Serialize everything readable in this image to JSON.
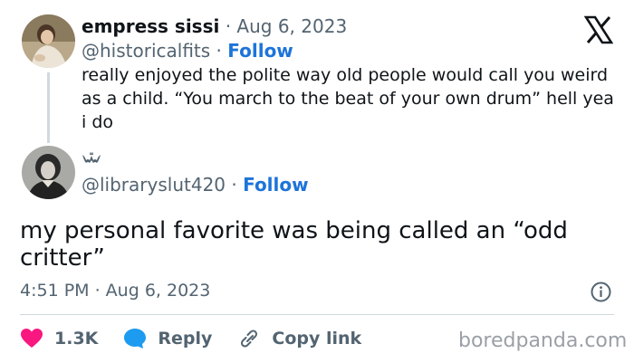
{
  "parent_tweet": {
    "display_name": "empress sissi",
    "separator": "·",
    "date": "Aug 6, 2023",
    "handle": "@historicalfits",
    "follow_label": "Follow",
    "text": "really enjoyed the polite way old people would call you weird as a child. “You march to the beat of your own drum” hell yea i do",
    "avatar_icon": "portrait-avatar"
  },
  "reply_tweet": {
    "name_icon": "bat-icon",
    "handle": "@libraryslut420",
    "separator": "·",
    "follow_label": "Follow",
    "text": "my personal favorite was being called an “odd critter”",
    "timestamp": "4:51 PM · Aug 6, 2023",
    "avatar_icon": "victorian-portrait-avatar"
  },
  "actions": {
    "likes": "1.3K",
    "reply_label": "Reply",
    "copy_link_label": "Copy link"
  },
  "logo": "x-logo",
  "watermark": "boredpanda.com",
  "colors": {
    "follow": "#1d74d9",
    "like": "#f91880",
    "reply": "#1d9bf0",
    "muted": "#536471"
  }
}
